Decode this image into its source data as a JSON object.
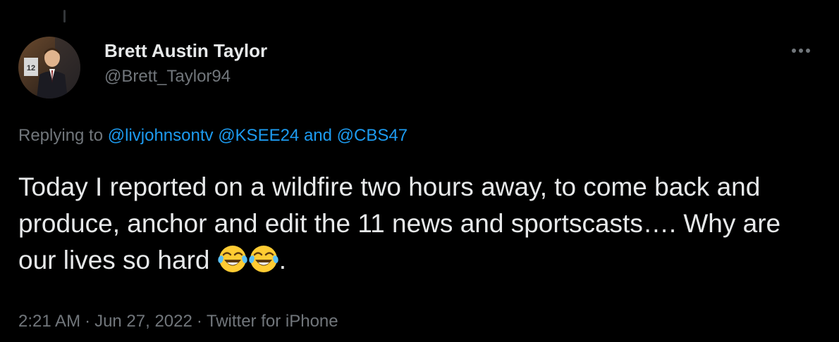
{
  "tweet": {
    "author": {
      "display_name": "Brett Austin Taylor",
      "handle": "@Brett_Taylor94",
      "avatar_badge": "12"
    },
    "reply_context": {
      "prefix": "Replying to",
      "mention_1": "@livjohnsontv",
      "mention_2": "@KSEE24",
      "conjunction": "and",
      "mention_3": "@CBS47"
    },
    "body": {
      "text": "Today I reported on a wildfire two hours away, to come back and produce, anchor and edit the 11 news and sportscasts…. Why are our lives so hard ",
      "emoji_1": "face-with-tears-of-joy-icon",
      "emoji_2": "face-with-tears-of-joy-icon",
      "trailing": "."
    },
    "meta": {
      "time": "2:21 AM",
      "separator": "·",
      "date": "Jun 27, 2022",
      "source": "Twitter for iPhone"
    },
    "more_icon": "more-horizontal-icon"
  },
  "colors": {
    "background": "#000000",
    "text_primary": "#e7e9ea",
    "text_secondary": "#71767b",
    "accent": "#1d9bf0"
  }
}
